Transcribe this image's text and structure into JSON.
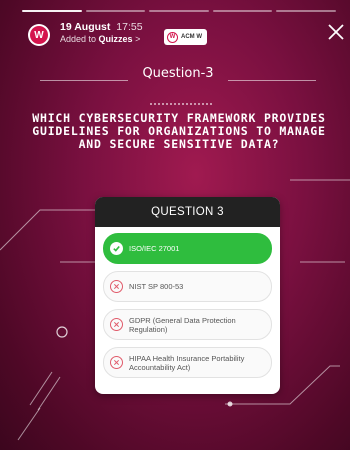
{
  "story": {
    "avatar_letter": "W",
    "date": "19 August",
    "time": "17:55",
    "added_prefix": "Added to ",
    "collection": "Quizzes",
    "chevron": ">",
    "chip_letter": "W",
    "chip_label": "ACM W",
    "close_icon": "close-icon",
    "progress_segments": 5,
    "active_segment": 1
  },
  "slide": {
    "title": "Question-3",
    "question": "Which Cybersecurity Framework Provides Guidelines for Organizations to Manage and Secure Sensitive Data?"
  },
  "quiz": {
    "header": "QUESTION 3",
    "options": [
      {
        "label": "ISO/IEC 27001",
        "state": "correct",
        "icon": "check-icon"
      },
      {
        "label": "NIST SP 800-53",
        "state": "wrong",
        "icon": "x-circle-icon"
      },
      {
        "label": "GDPR (General Data Protection Regulation)",
        "state": "wrong",
        "icon": "x-circle-icon"
      },
      {
        "label": "HIPAA Health Insurance Portability Accountability Act)",
        "state": "wrong",
        "icon": "x-circle-icon"
      }
    ]
  },
  "colors": {
    "background": "#7a1040",
    "brand": "#d4154d",
    "correct": "#2fbd3e",
    "wrong": "#e05a6a",
    "card_header": "#222222"
  }
}
